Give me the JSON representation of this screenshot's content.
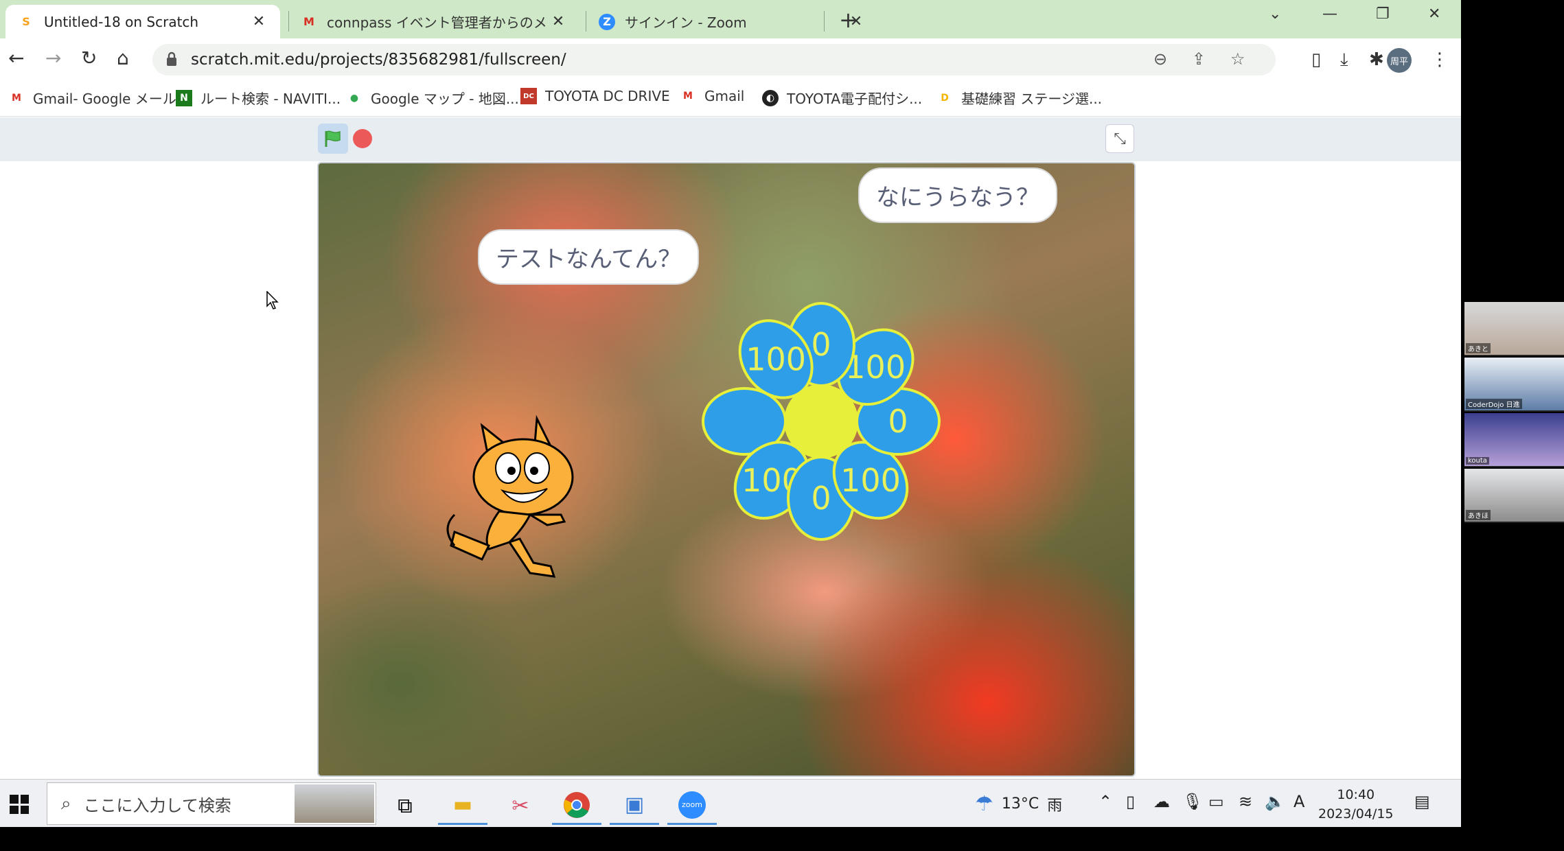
{
  "browser": {
    "tabs": [
      {
        "title": "Untitled-18 on Scratch",
        "active": true
      },
      {
        "title": "connpass イベント管理者からのメッセ"
      },
      {
        "title": "サインイン - Zoom"
      }
    ],
    "url": "scratch.mit.edu/projects/835682981/fullscreen/",
    "profile": "周平",
    "bookmarks": [
      "Gmail- Google メール",
      "ルート検索 - NAVITI...",
      "Google マップ - 地図...",
      "TOYOTA DC DRIVE",
      "Gmail",
      "TOYOTA電子配付シ...",
      "基礎練習 ステージ選..."
    ]
  },
  "stage": {
    "cat_bubble": "テストなんてん？",
    "flower_bubble": "なにうらなう？",
    "petals": [
      "100",
      "0",
      "100",
      "0",
      "100",
      "0",
      "100",
      ""
    ]
  },
  "taskbar": {
    "search_placeholder": "ここに入力して検索",
    "temperature": "13°C",
    "weather": "雨",
    "ime": "A",
    "time": "10:40",
    "date": "2023/04/15"
  },
  "zoom": {
    "participants": [
      "あきと",
      "CoderDojo 日進",
      "kouta",
      "あきほ"
    ]
  },
  "colors": {
    "tab_strip": "#cfe8c8",
    "petal_fill": "#2f9ee8",
    "petal_stroke": "#e6ef3a",
    "flower_center": "#e8ef3a"
  }
}
